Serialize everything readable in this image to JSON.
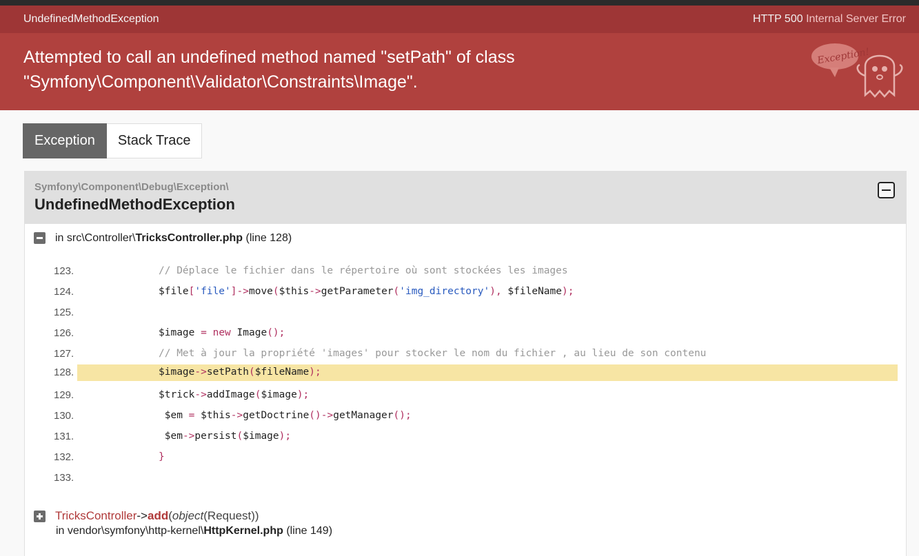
{
  "header": {
    "exception_short": "UndefinedMethodException",
    "status_code": "HTTP 500",
    "status_text": "Internal Server Error",
    "message_line1": "Attempted to call an undefined method named \"setPath\" of class",
    "message_line2": "\"Symfony\\Component\\Validator\\Constraints\\Image\".",
    "ghost_bubble": "Exception!"
  },
  "tabs": [
    {
      "label": "Exception",
      "active": true
    },
    {
      "label": "Stack Trace",
      "active": false
    }
  ],
  "exception": {
    "namespace": "Symfony\\Component\\Debug\\Exception\\",
    "class": "UndefinedMethodException"
  },
  "frame1": {
    "in": "in",
    "path_prefix": "src\\Controller\\",
    "file": "TricksController.php",
    "line_info": "(line 128)"
  },
  "code_lines": [
    {
      "no": "123.",
      "code": "// Déplace le fichier dans le répertoire où sont stockées les images"
    },
    {
      "no": "124.",
      "code": "$file['file']->move($this->getParameter('img_directory'), $fileName);"
    },
    {
      "no": "125.",
      "code": ""
    },
    {
      "no": "126.",
      "code": "$image = new Image();"
    },
    {
      "no": "127.",
      "code": "// Met à jour la propriété 'images' pour stocker le nom du fichier , au lieu de son contenu"
    },
    {
      "no": "128.",
      "code": "$image->setPath($fileName);"
    },
    {
      "no": "129.",
      "code": "$trick->addImage($image);"
    },
    {
      "no": "130.",
      "code": " $em = $this->getDoctrine()->getManager();"
    },
    {
      "no": "131.",
      "code": " $em->persist($image);"
    },
    {
      "no": "132.",
      "code": "}"
    },
    {
      "no": "133.",
      "code": ""
    }
  ],
  "highlight_line": "128.",
  "frame2": {
    "class": "TricksController",
    "arrow": "->",
    "method": "add",
    "args_type": "object",
    "args_value": "(Request)",
    "in": "in",
    "path_prefix": "vendor\\symfony\\http-kernel\\",
    "file": "HttpKernel.php",
    "line_info": "(line 149)"
  },
  "colors": {
    "summary_bar": "#9e3636",
    "message_bar": "#b0413e",
    "highlight": "#f7e5a4",
    "active_tab": "#666666"
  }
}
